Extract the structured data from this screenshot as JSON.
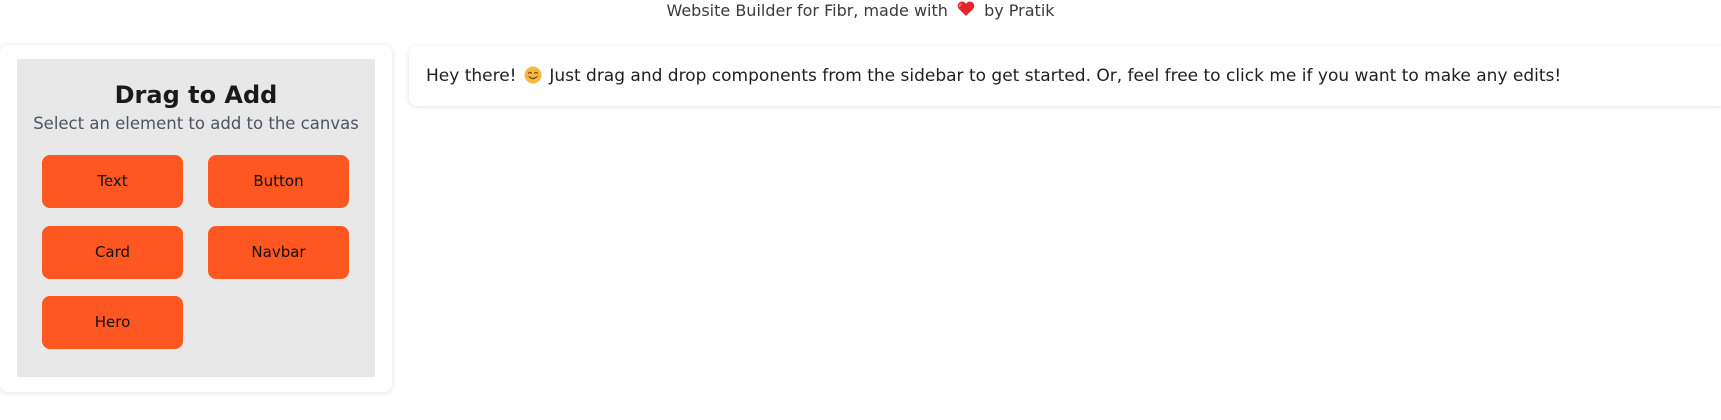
{
  "header": {
    "text_before": "Website Builder for Fibr, made with",
    "heart_icon": "heart-icon",
    "heart_color": "#e5242c",
    "text_after": "by Pratik"
  },
  "sidebar": {
    "title": "Drag to Add",
    "subtitle": "Select an element to add to the canvas",
    "background": "#e8e8e8",
    "button_color": "#ff5722",
    "items": [
      {
        "label": "Text"
      },
      {
        "label": "Button"
      },
      {
        "label": "Card"
      },
      {
        "label": "Navbar"
      },
      {
        "label": "Hero"
      }
    ]
  },
  "canvas": {
    "text_before": "Hey there!",
    "smile_icon": "smiling-face-icon",
    "text_after": "Just drag and drop components from the sidebar to get started. Or, feel free to click me if you want to make any edits!"
  }
}
